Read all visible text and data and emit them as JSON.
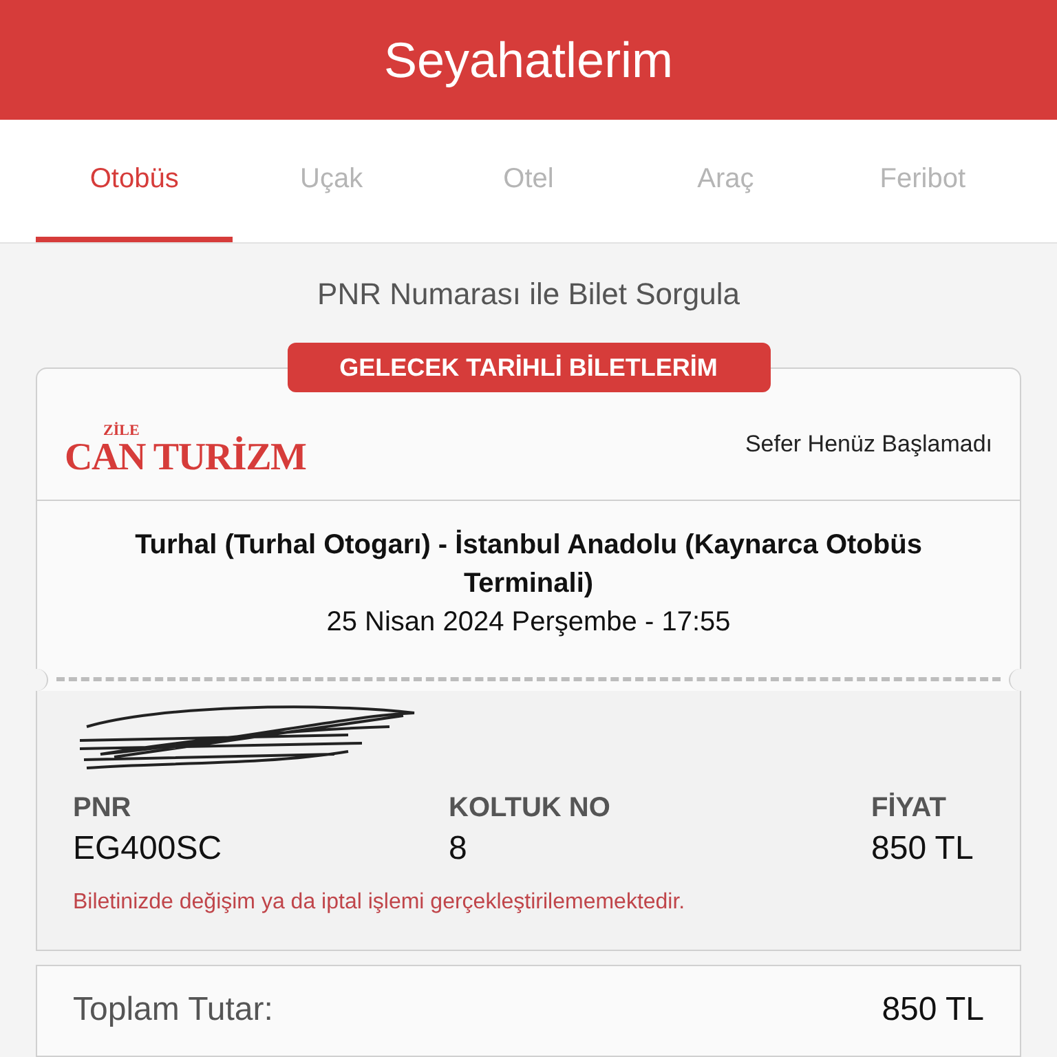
{
  "header": {
    "title": "Seyahatlerim"
  },
  "tabs": [
    {
      "label": "Otobüs",
      "selected": true
    },
    {
      "label": "Uçak",
      "selected": false
    },
    {
      "label": "Otel",
      "selected": false
    },
    {
      "label": "Araç",
      "selected": false
    },
    {
      "label": "Feribot",
      "selected": false
    }
  ],
  "pnr_link": "PNR Numarası ile Bilet Sorgula",
  "section_badge": "GELECEK TARİHLİ BİLETLERİM",
  "ticket": {
    "company_logo": {
      "small": "ZİLE",
      "main": "CAN TURİZM"
    },
    "status": "Sefer Henüz Başlamadı",
    "route": "Turhal (Turhal Otogarı) - İstanbul Anadolu (Kaynarca Otobüs Terminali)",
    "datetime": "25 Nisan 2024 Perşembe - 17:55",
    "fields": [
      {
        "label": "PNR",
        "value": "EG400SC"
      },
      {
        "label": "KOLTUK NO",
        "value": "8"
      },
      {
        "label": "FİYAT",
        "value": "850 TL"
      }
    ],
    "notice": "Biletinizde değişim ya da iptal işlemi gerçekleştirilememektedir."
  },
  "total": {
    "label": "Toplam Tutar:",
    "value": "850 TL"
  }
}
